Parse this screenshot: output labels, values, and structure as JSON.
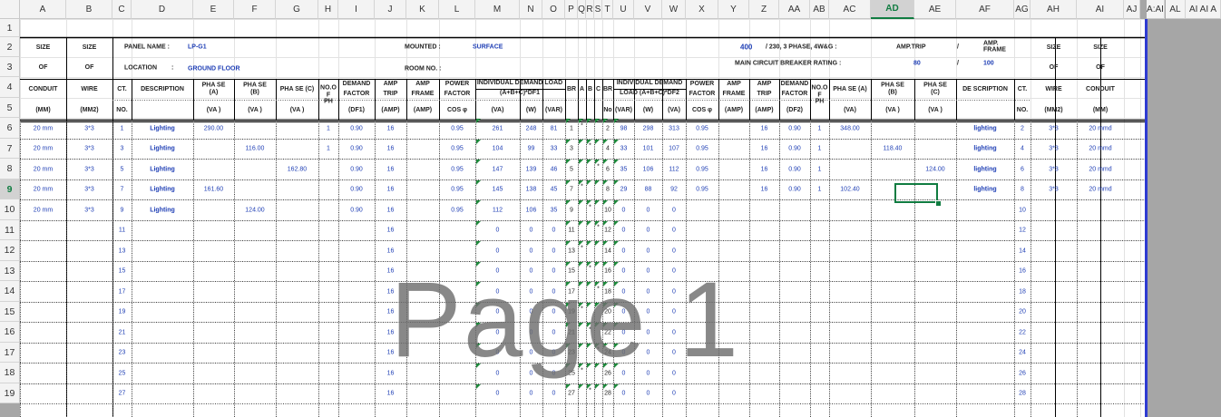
{
  "columns": [
    "A",
    "B",
    "C",
    "D",
    "E",
    "F",
    "G",
    "H",
    "I",
    "J",
    "K",
    "L",
    "M",
    "N",
    "O",
    "P",
    "Q",
    "R",
    "S",
    "T",
    "U",
    "V",
    "W",
    "X",
    "Y",
    "Z",
    "AA",
    "AB",
    "AC",
    "AD",
    "AE",
    "AF",
    "AG",
    "AH",
    "AI",
    "AJ",
    "AK",
    "AL",
    "AM",
    "AN"
  ],
  "column_labels": {
    "extra": "A:AI",
    "al": "AL",
    "am": "AI AI A"
  },
  "rows": [
    "1",
    "2",
    "3",
    "4",
    "5",
    "6",
    "7",
    "8",
    "9",
    "10",
    "11",
    "12",
    "13",
    "14",
    "15",
    "16",
    "17",
    "18",
    "19"
  ],
  "selected": {
    "column": "AD",
    "row": "9"
  },
  "header": {
    "panel_name_label": "PANEL NAME :",
    "panel_name": "LP-G1",
    "mounted_label": "MOUNTED  :",
    "mounted": "SURFACE",
    "voltage": "400",
    "voltage_desc": "/ 230, 3 PHASE, 4W&G :",
    "amp_trip_label": "AMP.TRIP",
    "slash": "/",
    "amp_frame_label": "AMP. FRAME",
    "location_label": "LOCATION",
    "colon": ":",
    "location": "GROUND FLOOR",
    "room_label": "ROOM NO.  :",
    "main_cb_label": "MAIN CIRCUIT BREAKER RATING :",
    "main_trip": "80",
    "main_frame": "100"
  },
  "left_cols": {
    "size": "SIZE",
    "of": "OF",
    "conduit": "CONDUIT",
    "mm": "(MM)",
    "wire": "WIRE",
    "mm2": "(MM2)"
  },
  "col_heads": {
    "ct": "CT.",
    "no": "NO.",
    "description": "DESCRIPTION",
    "phase_a": "PHA SE\n(A)",
    "phase_b": "PHA SE\n(B)",
    "phase_c": "PHA SE  (C)",
    "va": "(VA )",
    "noof": "NO.O\nF\nPH",
    "demand": "DEMAND",
    "factor": "FACTOR",
    "df1": "(DF1)",
    "df2": "(DF2)",
    "amp": "AMP",
    "trip": "TRIP",
    "frame": "FRAME",
    "ampu": "(AMP)",
    "power": "POWER",
    "pfactor": "FACTOR",
    "cos": "COS φ",
    "indiv1": "INDIVIDUAL DEMAND LOAD",
    "indiv1b": "(A+B+C)*DF1",
    "indiv2": "INDIVIDUAL DEMAND",
    "indiv2b": "LOAD (A+B+C)*DF2",
    "vau": "(VA)",
    "w": "(W)",
    "var": "(VAR)",
    "br": "BR",
    "brno": "No",
    "a": "A",
    "b": "B",
    "c": "C",
    "phase_a2": "PHA SE  (A)",
    "phase_b2": "PHA SE\n(B)",
    "phase_c2": "PHA SE\n(C)",
    "vau2": "(VA )",
    "va2": "(VA)",
    "description2": "DE SCRIPTION",
    "ct2": "CT.",
    "no2": "NO.",
    "wire2": "WIRE",
    "mm2b": "(MM2)",
    "conduit2": "CONDUIT",
    "mmb": "(MM)"
  },
  "data_rows": [
    {
      "conduit": "20 mm",
      "wire": "3*3",
      "ct": "1",
      "desc": "Lighting",
      "pa": "290.00",
      "pb": "",
      "pc": "",
      "nph": "1",
      "df": "0.90",
      "trip": "16",
      "pf": "0.95",
      "va": "261",
      "w": "248",
      "var": "81",
      "br": "1",
      "mark": "*",
      "markc": "a",
      "br2": "2",
      "var2": "98",
      "w2": "298",
      "va2": "313",
      "pf2": "0.95",
      "trip2": "16",
      "df2": "0.90",
      "nph2": "1",
      "pa2": "348.00",
      "pb2": "",
      "pc2": "",
      "desc2": "lighting",
      "ct2": "2",
      "wire2": "3*3",
      "conduit2": "20 mmd"
    },
    {
      "conduit": "20 mm",
      "wire": "3*3",
      "ct": "3",
      "desc": "Lighting",
      "pa": "",
      "pb": "116.00",
      "pc": "",
      "nph": "1",
      "df": "0.90",
      "trip": "16",
      "pf": "0.95",
      "va": "104",
      "w": "99",
      "var": "33",
      "br": "3",
      "mark": "*",
      "markc": "b",
      "br2": "4",
      "var2": "33",
      "w2": "101",
      "va2": "107",
      "pf2": "0.95",
      "trip2": "16",
      "df2": "0.90",
      "nph2": "1",
      "pa2": "",
      "pb2": "118.40",
      "pc2": "",
      "desc2": "lighting",
      "ct2": "4",
      "wire2": "3*3",
      "conduit2": "20 mmd"
    },
    {
      "conduit": "20 mm",
      "wire": "3*3",
      "ct": "5",
      "desc": "Lighting",
      "pa": "",
      "pb": "",
      "pc": "162.80",
      "nph": "",
      "df": "0.90",
      "trip": "16",
      "pf": "0.95",
      "va": "147",
      "w": "139",
      "var": "46",
      "br": "5",
      "mark": "*",
      "markc": "c",
      "br2": "6",
      "var2": "35",
      "w2": "106",
      "va2": "112",
      "pf2": "0.95",
      "trip2": "16",
      "df2": "0.90",
      "nph2": "1",
      "pa2": "",
      "pb2": "",
      "pc2": "124.00",
      "desc2": "lighting",
      "ct2": "6",
      "wire2": "3*3",
      "conduit2": "20 mmd"
    },
    {
      "conduit": "20 mm",
      "wire": "3*3",
      "ct": "7",
      "desc": "Lighting",
      "pa": "161.60",
      "pb": "",
      "pc": "",
      "nph": "",
      "df": "0.90",
      "trip": "16",
      "pf": "0.95",
      "va": "145",
      "w": "138",
      "var": "45",
      "br": "7",
      "mark": "*",
      "markc": "a",
      "br2": "8",
      "var2": "29",
      "w2": "88",
      "va2": "92",
      "pf2": "0.95",
      "trip2": "16",
      "df2": "0.90",
      "nph2": "1",
      "pa2": "102.40",
      "pb2": "",
      "pc2": "",
      "desc2": "lighting",
      "ct2": "8",
      "wire2": "3*3",
      "conduit2": "20 mmd"
    },
    {
      "conduit": "20 mm",
      "wire": "3*3",
      "ct": "9",
      "desc": "Lighting",
      "pa": "",
      "pb": "124.00",
      "pc": "",
      "nph": "",
      "df": "0.90",
      "trip": "16",
      "pf": "0.95",
      "va": "112",
      "w": "106",
      "var": "35",
      "br": "9",
      "mark": "*",
      "markc": "b",
      "br2": "10",
      "var2": "0",
      "w2": "0",
      "va2": "0",
      "pf2": "",
      "trip2": "",
      "df2": "",
      "nph2": "",
      "pa2": "",
      "pb2": "",
      "pc2": "",
      "desc2": "",
      "ct2": "10",
      "wire2": "",
      "conduit2": ""
    },
    {
      "ct": "11",
      "trip": "16",
      "va": "0",
      "w": "0",
      "var": "0",
      "br": "11",
      "mark": "*",
      "markc": "c",
      "br2": "12",
      "var2": "0",
      "w2": "0",
      "va2": "0",
      "ct2": "12"
    },
    {
      "ct": "13",
      "trip": "16",
      "va": "0",
      "w": "0",
      "var": "0",
      "br": "13",
      "mark": "*",
      "markc": "a",
      "br2": "14",
      "var2": "0",
      "w2": "0",
      "va2": "0",
      "ct2": "14"
    },
    {
      "ct": "15",
      "trip": "16",
      "va": "0",
      "w": "0",
      "var": "0",
      "br": "15",
      "mark": "*",
      "markc": "b",
      "br2": "16",
      "var2": "0",
      "w2": "0",
      "va2": "0",
      "ct2": "16"
    },
    {
      "ct": "17",
      "trip": "16",
      "va": "0",
      "w": "0",
      "var": "0",
      "br": "17",
      "mark": "*",
      "markc": "c",
      "br2": "18",
      "var2": "0",
      "w2": "0",
      "va2": "0",
      "ct2": "18"
    },
    {
      "ct": "19",
      "trip": "16",
      "va": "0",
      "w": "0",
      "var": "0",
      "br": "19",
      "mark": "*",
      "markc": "a",
      "br2": "20",
      "var2": "0",
      "w2": "0",
      "va2": "0",
      "ct2": "20"
    },
    {
      "ct": "21",
      "trip": "16",
      "va": "0",
      "w": "0",
      "var": "0",
      "br": "21",
      "mark": "*",
      "markc": "b",
      "br2": "22",
      "var2": "0",
      "w2": "0",
      "va2": "0",
      "ct2": "22"
    },
    {
      "ct": "23",
      "trip": "16",
      "va": "0",
      "w": "0",
      "var": "0",
      "br": "23",
      "mark": "*",
      "markc": "c",
      "br2": "24",
      "var2": "0",
      "w2": "0",
      "va2": "0",
      "ct2": "24"
    },
    {
      "ct": "25",
      "trip": "16",
      "va": "0",
      "w": "0",
      "var": "0",
      "br": "25",
      "mark": "*",
      "markc": "a",
      "br2": "26",
      "var2": "0",
      "w2": "0",
      "va2": "0",
      "ct2": "26"
    },
    {
      "ct": "27",
      "trip": "16",
      "va": "0",
      "w": "0",
      "var": "0",
      "br": "27",
      "mark": "*",
      "markc": "b",
      "br2": "28",
      "var2": "0",
      "w2": "0",
      "va2": "0",
      "ct2": "28"
    }
  ],
  "watermark": "Page 1"
}
